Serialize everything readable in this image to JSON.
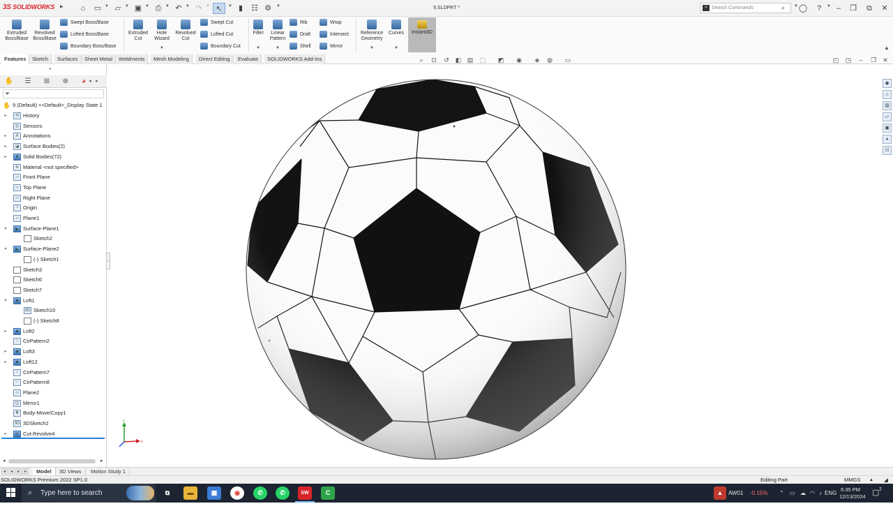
{
  "app": {
    "logo_text": "SOLIDWORKS",
    "document_title": "9.SLDPRT *",
    "search_placeholder": "Search Commands"
  },
  "ribbon": {
    "extruded_boss": "Extruded Boss/Base",
    "revolved_boss": "Revolved Boss/Base",
    "swept_boss": "Swept Boss/Base",
    "lofted_boss": "Lofted Boss/Base",
    "boundary_boss": "Boundary Boss/Base",
    "extruded_cut": "Extruded Cut",
    "hole_wizard": "Hole Wizard",
    "revolved_cut": "Revolved Cut",
    "swept_cut": "Swept Cut",
    "lofted_cut": "Lofted Cut",
    "boundary_cut": "Boundary Cut",
    "fillet": "Fillet",
    "linear_pattern": "Linear Pattern",
    "rib": "Rib",
    "draft": "Draft",
    "shell": "Shell",
    "wrap": "Wrap",
    "intersect": "Intersect",
    "mirror": "Mirror",
    "reference_geometry": "Reference Geometry",
    "curves": "Curves",
    "instant3d": "Instant3D"
  },
  "tabs": [
    "Features",
    "Sketch",
    "Surfaces",
    "Sheet Metal",
    "Weldments",
    "Mesh Modeling",
    "Direct Editing",
    "Evaluate",
    "SOLIDWORKS Add-Ins"
  ],
  "tree": {
    "root": "9 (Default) <<Default>_Display State 1",
    "items": [
      {
        "label": "History",
        "icon": "history-icon",
        "indent": 0,
        "expander": "right"
      },
      {
        "label": "Sensors",
        "icon": "sensor-icon",
        "indent": 0,
        "expander": ""
      },
      {
        "label": "Annotations",
        "icon": "annotation-icon",
        "indent": 0,
        "expander": "right"
      },
      {
        "label": "Surface Bodies(2)",
        "icon": "surface-bodies-icon",
        "indent": 0,
        "expander": "right"
      },
      {
        "label": "Solid Bodies(72)",
        "icon": "solid-bodies-icon",
        "indent": 0,
        "expander": "right"
      },
      {
        "label": "Material <not specified>",
        "icon": "material-icon",
        "indent": 0,
        "expander": ""
      },
      {
        "label": "Front Plane",
        "icon": "plane-icon",
        "indent": 0,
        "expander": ""
      },
      {
        "label": "Top Plane",
        "icon": "plane-icon",
        "indent": 0,
        "expander": ""
      },
      {
        "label": "Right Plane",
        "icon": "plane-icon",
        "indent": 0,
        "expander": ""
      },
      {
        "label": "Origin",
        "icon": "origin-icon",
        "indent": 0,
        "expander": ""
      },
      {
        "label": "Plane1",
        "icon": "plane-icon",
        "indent": 0,
        "expander": ""
      },
      {
        "label": "Surface-Plane1",
        "icon": "surface-plane-icon",
        "indent": 0,
        "expander": "down"
      },
      {
        "label": "Sketch2",
        "icon": "sketch-icon",
        "indent": 1,
        "expander": ""
      },
      {
        "label": "Surface-Plane2",
        "icon": "surface-plane-icon",
        "indent": 0,
        "expander": "down"
      },
      {
        "label": "(-) Sketch1",
        "icon": "sketch-icon",
        "indent": 1,
        "expander": ""
      },
      {
        "label": "Sketch3",
        "icon": "sketch-icon",
        "indent": 0,
        "expander": ""
      },
      {
        "label": "Sketch6",
        "icon": "sketch-icon",
        "indent": 0,
        "expander": ""
      },
      {
        "label": "Sketch7",
        "icon": "sketch-icon",
        "indent": 0,
        "expander": ""
      },
      {
        "label": "Loft1",
        "icon": "loft-icon",
        "indent": 0,
        "expander": "down"
      },
      {
        "label": "Sketch10",
        "icon": "3d-sketch-icon",
        "indent": 1,
        "expander": ""
      },
      {
        "label": "(-) Sketch8",
        "icon": "sketch-icon",
        "indent": 1,
        "expander": ""
      },
      {
        "label": "Loft2",
        "icon": "loft-icon",
        "indent": 0,
        "expander": "right"
      },
      {
        "label": "CirPattern2",
        "icon": "circular-pattern-icon",
        "indent": 0,
        "expander": ""
      },
      {
        "label": "Loft3",
        "icon": "loft-icon",
        "indent": 0,
        "expander": "right"
      },
      {
        "label": "Loft12",
        "icon": "loft-icon",
        "indent": 0,
        "expander": "right"
      },
      {
        "label": "CirPattern7",
        "icon": "circular-pattern-icon",
        "indent": 0,
        "expander": ""
      },
      {
        "label": "CirPattern8",
        "icon": "circular-pattern-icon",
        "indent": 0,
        "expander": ""
      },
      {
        "label": "Plane2",
        "icon": "plane-icon",
        "indent": 0,
        "expander": ""
      },
      {
        "label": "Mirror1",
        "icon": "mirror-icon",
        "indent": 0,
        "expander": ""
      },
      {
        "label": "Body-Move/Copy1",
        "icon": "move-copy-icon",
        "indent": 0,
        "expander": ""
      },
      {
        "label": "3DSketch2",
        "icon": "3d-sketch-icon",
        "indent": 0,
        "expander": ""
      },
      {
        "label": "Cut-Revolve4",
        "icon": "cut-revolve-icon",
        "indent": 0,
        "expander": "right"
      }
    ]
  },
  "bottom_tabs": [
    "Model",
    "3D Views",
    "Motion Study 1"
  ],
  "status": {
    "left": "SOLIDWORKS Premium 2022 SP1.0",
    "mode": "Editing Part",
    "units": "MMGS"
  },
  "taskbar": {
    "search": "Type here to search",
    "ticker": "AW01",
    "ticker_change": "-0.15%",
    "lang": "ENG",
    "time": "6:35 PM",
    "date": "12/13/2024",
    "notifications": "2"
  },
  "colors": {
    "accent_red": "#d8252a",
    "panel_blue": "#2a7fd8",
    "ticker_red": "#ff6b6b"
  }
}
